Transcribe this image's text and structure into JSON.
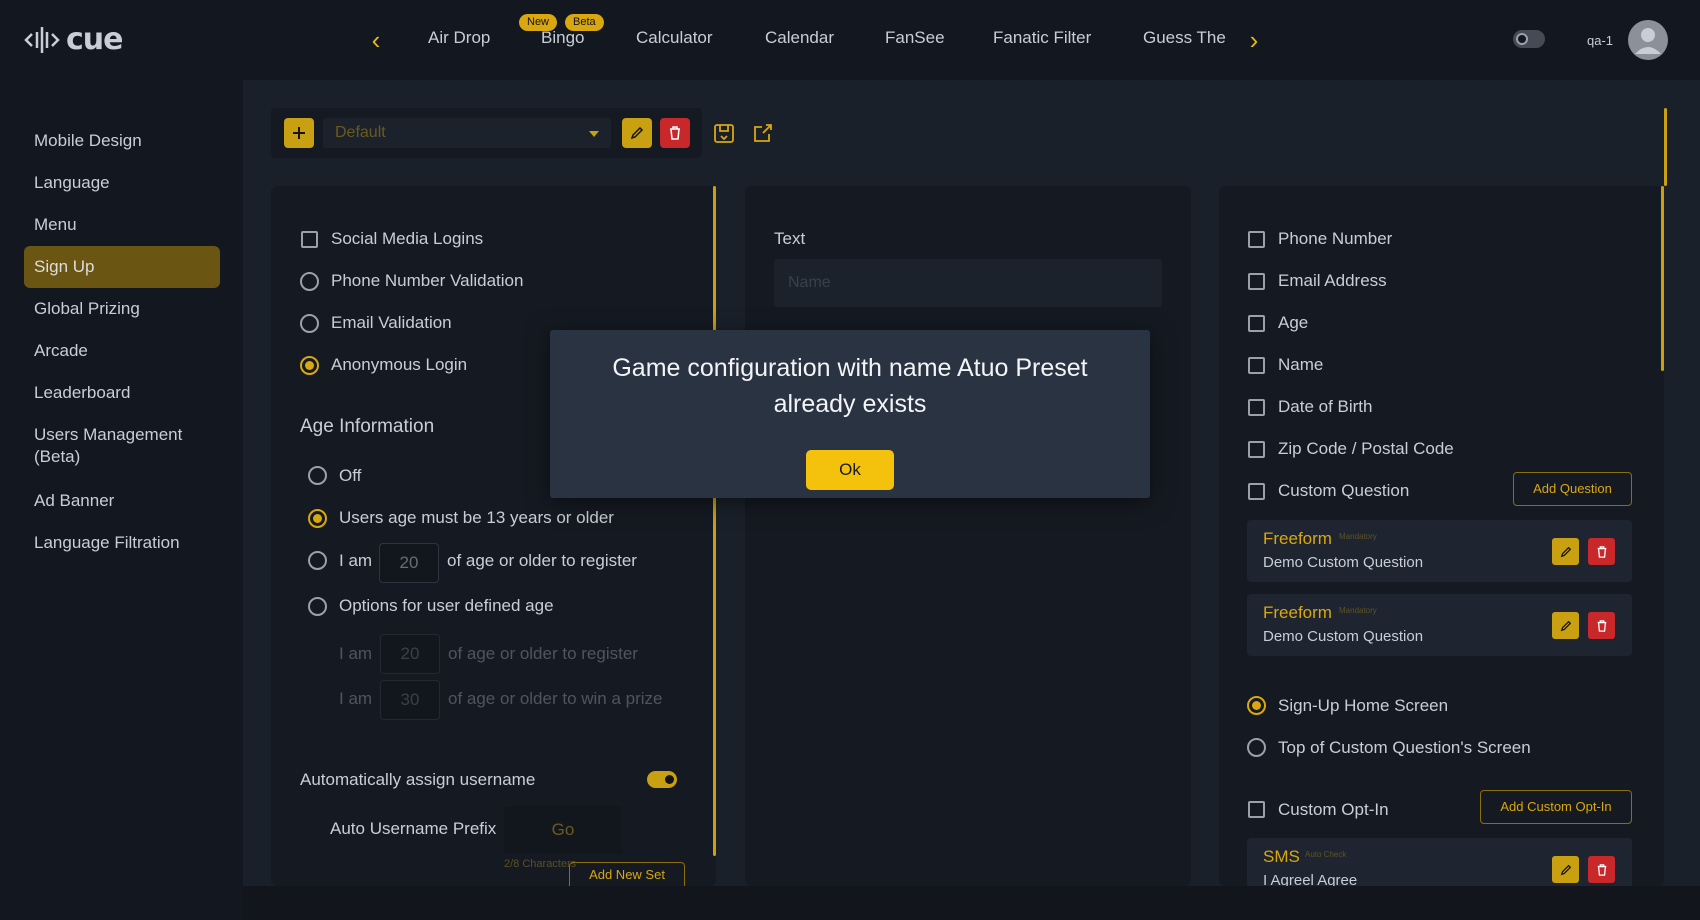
{
  "app": {
    "logo_text": "cue",
    "user_name": "qa-1"
  },
  "top_nav": {
    "items": [
      "Air Drop",
      "Bingo",
      "Calculator",
      "Calendar",
      "FanSee",
      "Fanatic Filter",
      "Guess The"
    ],
    "bingo_badges": [
      "New",
      "Beta"
    ],
    "prev_icon": "chevron-left-icon",
    "next_icon": "chevron-right-icon"
  },
  "sidebar": {
    "items": [
      "Mobile Design",
      "Language",
      "Menu",
      "Sign Up",
      "Global Prizing",
      "Arcade",
      "Leaderboard",
      "Users Management (Beta)",
      "Ad Banner",
      "Language Filtration"
    ],
    "active": "Sign Up"
  },
  "toolbar": {
    "preset_value": "Default"
  },
  "left_panel": {
    "login_options": [
      {
        "label": "Social Media Logins",
        "type": "checkbox",
        "checked": false
      },
      {
        "label": "Phone Number Validation",
        "type": "radio",
        "checked": false
      },
      {
        "label": "Email Validation",
        "type": "radio",
        "checked": false
      },
      {
        "label": "Anonymous Login",
        "type": "radio",
        "checked": true
      }
    ],
    "age_title": "Age Information",
    "age_off": "Off",
    "age_13": "Users age must be 13 years or older",
    "age_i_am": "I am",
    "age_value": "20",
    "age_suffix": "of age or older to register",
    "age_user_defined": "Options for user defined age",
    "sub_i_am_1": "I am",
    "sub_value_1": "20",
    "sub_suffix_1": "of age or older to register",
    "sub_i_am_2": "I am",
    "sub_value_2": "30",
    "sub_suffix_2": "of age or older to win a prize",
    "auto_username": "Automatically assign username",
    "auto_username_on": true,
    "prefix_label": "Auto Username Prefix",
    "prefix_value": "Go",
    "prefix_count": "2/8 Characters",
    "add_new_set": "Add New Set"
  },
  "middle_panel": {
    "text_label": "Text",
    "name_placeholder": "Name"
  },
  "right_panel": {
    "fields": [
      "Phone Number",
      "Email Address",
      "Age",
      "Name",
      "Date of Birth",
      "Zip Code / Postal Code",
      "Custom Question"
    ],
    "add_question": "Add Question",
    "questions": [
      {
        "type": "Freeform",
        "tag": "Mandatory",
        "text": "Demo Custom Question"
      },
      {
        "type": "Freeform",
        "tag": "Mandatory",
        "text": "Demo Custom Question"
      }
    ],
    "screen_options": [
      {
        "label": "Sign-Up Home Screen",
        "checked": true
      },
      {
        "label": "Top of Custom Question's Screen",
        "checked": false
      }
    ],
    "custom_optin": "Custom Opt-In",
    "add_custom_optin": "Add Custom Opt-In",
    "optins": [
      {
        "type": "SMS",
        "tag": "Auto Check",
        "text": "I Agreel Agree"
      }
    ]
  },
  "modal": {
    "message": "Game configuration with name Atuo Preset already exists",
    "ok_label": "Ok"
  },
  "colors": {
    "accent": "#f4c20d",
    "danger": "#c9282b",
    "background": "#121720",
    "panel": "#151a22"
  }
}
